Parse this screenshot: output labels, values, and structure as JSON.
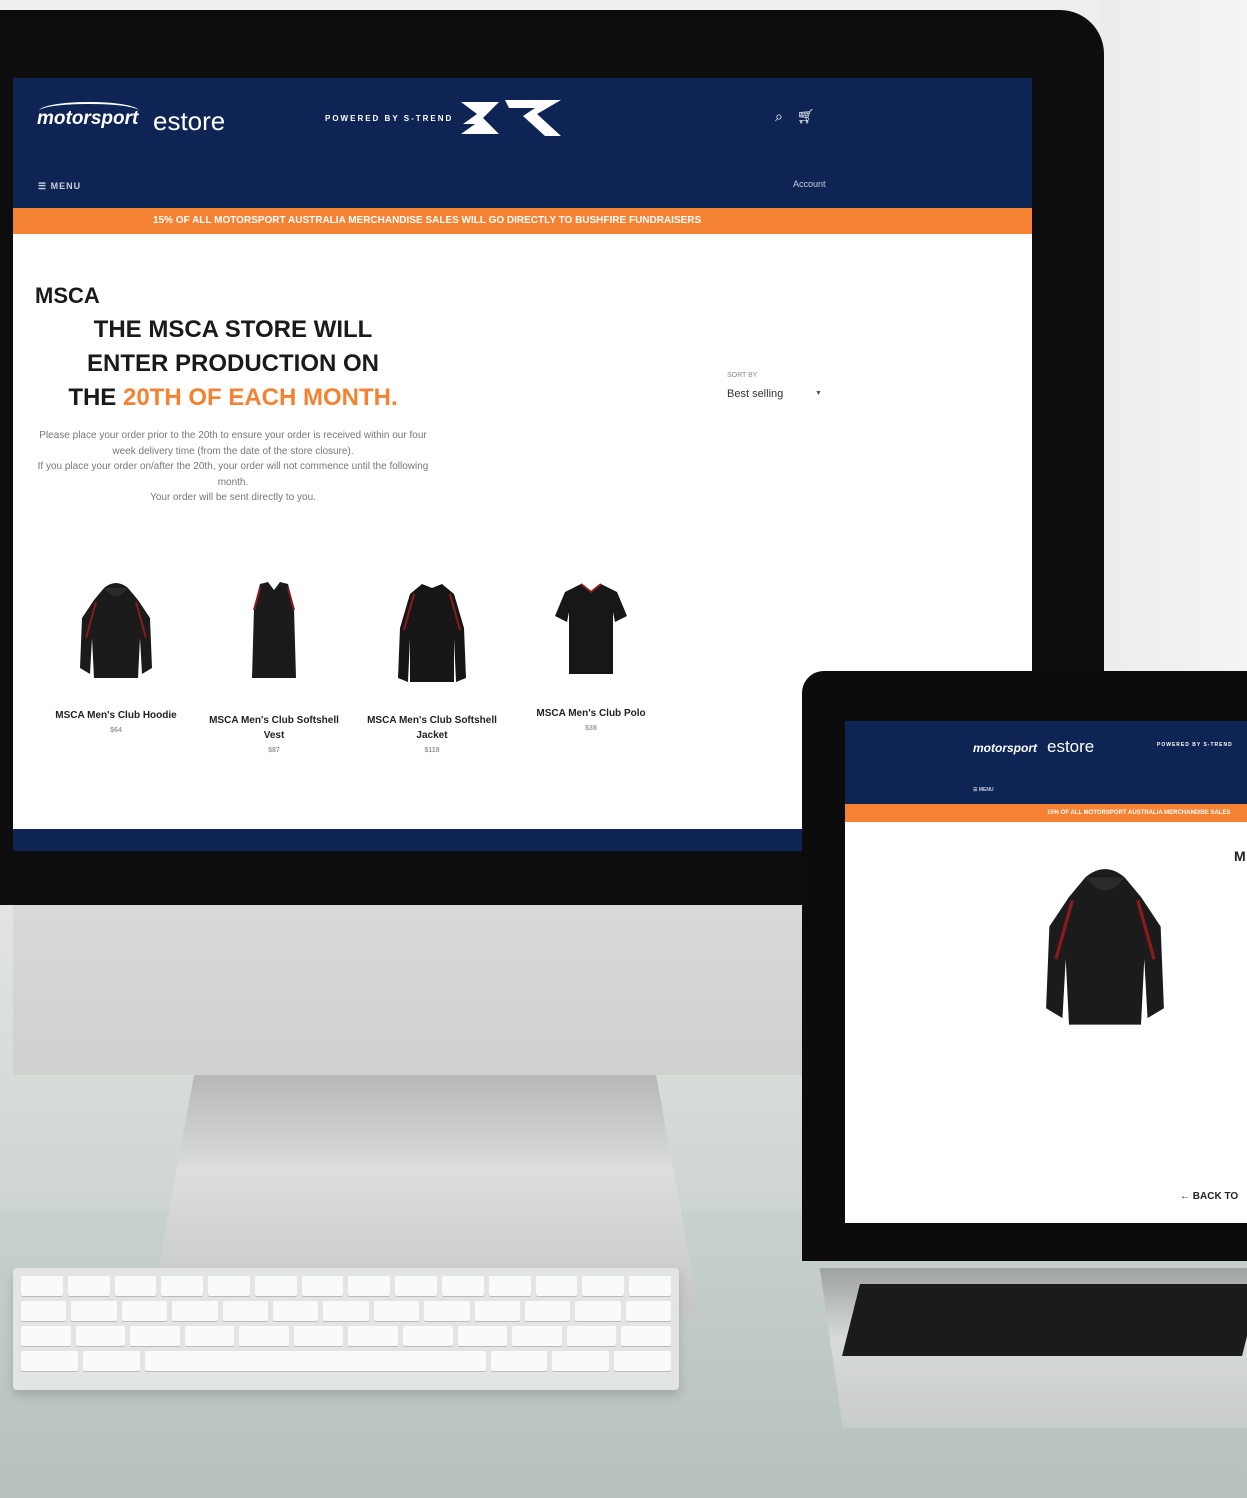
{
  "site": {
    "brand_primary": "motorsport",
    "brand_secondary": "estore",
    "powered_by": "POWERED BY S-TREND",
    "menu_label": "MENU",
    "account_label": "Account",
    "promo_banner": "15% OF ALL MOTORSPORT AUSTRALIA MERCHANDISE SALES WILL GO DIRECTLY TO BUSHFIRE FUNDRAISERS",
    "colors": {
      "navy": "#0e2454",
      "orange": "#f58233"
    },
    "icons": [
      "search-icon",
      "cart-icon",
      "menu-icon"
    ]
  },
  "collection": {
    "title": "MSCA",
    "headline_line1": "THE MSCA STORE WILL",
    "headline_line2": "ENTER PRODUCTION ON",
    "headline_line3_prefix": "THE ",
    "headline_line3_accent": "20TH OF EACH MONTH.",
    "notice_1": "Please place your order prior to the 20th to ensure your order is received within our four week delivery time (from the date of the store closure).",
    "notice_2": "If you place your order on/after the 20th, your order will not commence until the following month.",
    "notice_3": "Your order will be sent directly to you.",
    "sort_label": "SORT BY",
    "sort_value": "Best selling"
  },
  "products": [
    {
      "name": "MSCA Men's Club Hoodie",
      "price": "$64"
    },
    {
      "name": "MSCA Men's Club Softshell Vest",
      "price": "$87"
    },
    {
      "name": "MSCA Men's Club Softshell Jacket",
      "price": "$118"
    },
    {
      "name": "MSCA Men's Club Polo",
      "price": "$38"
    }
  ],
  "laptop": {
    "brand_secondary": "estore",
    "powered_by": "POWERED BY S-TREND",
    "menu_label": "MENU",
    "promo_banner": "15% OF ALL MOTORSPORT AUSTRALIA MERCHANDISE SALES",
    "title_partial": "M",
    "back_link": "← BACK TO"
  }
}
